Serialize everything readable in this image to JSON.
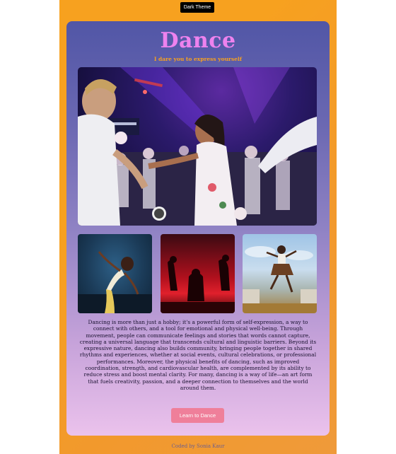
{
  "theme_toggle": {
    "label": "Dark Theme"
  },
  "header": {
    "title": "Dance",
    "subtitle": "I dare you to express yourself"
  },
  "images": {
    "hero": {
      "icon": "dance-party-photo"
    },
    "thumbnails": [
      {
        "icon": "solo-dancer-photo"
      },
      {
        "icon": "silhouette-dancers-photo"
      },
      {
        "icon": "outdoor-dancer-photo"
      }
    ]
  },
  "main": {
    "paragraph": "Dancing is more than just a hobby; it's a powerful form of self-expression, a way to connect with others, and a tool for emotional and physical well-being. Through movement, people can communicate feelings and stories that words cannot capture, creating a universal language that transcends cultural and linguistic barriers. Beyond its expressive nature, dancing also builds community, bringing people together in shared rhythms and experiences, whether at social events, cultural celebrations, or professional performances. Moreover, the physical benefits of dancing, such as improved coordination, strength, and cardiovascular health, are complemented by its ability to reduce stress and boost mental clarity. For many, dancing is a way of life—an art form that fuels creativity, passion, and a deeper connection to themselves and the world around them."
  },
  "cta": {
    "label": "Learn to Dance"
  },
  "footer": {
    "credit": "Coded by Sonia Kaur"
  },
  "colors": {
    "page_background": "#f7a11f",
    "title": "#ee82ee",
    "subtitle": "#f7a11f",
    "cta": "#ef7f9a",
    "card_top": "#5156a6",
    "card_bottom": "#ebc2ec"
  }
}
